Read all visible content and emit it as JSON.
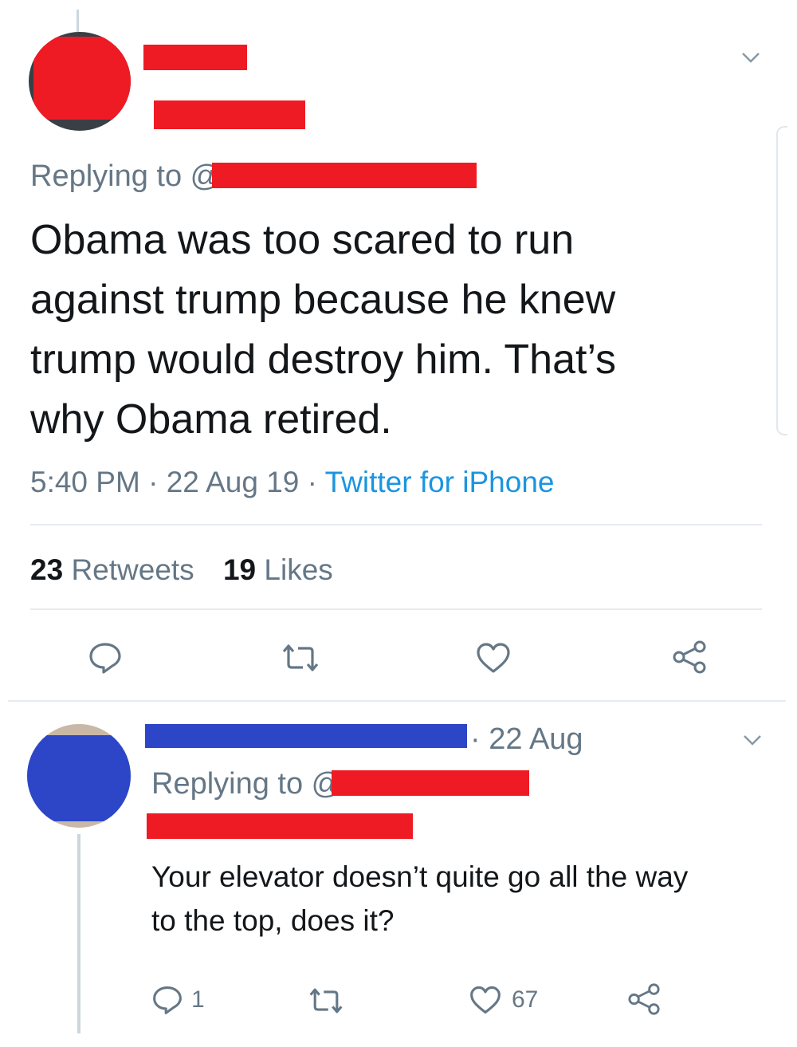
{
  "main_tweet": {
    "replying_prefix": "Replying to @",
    "text_lines": [
      "Obama was too scared to run",
      "against trump because he knew",
      "trump would destroy him. That’s",
      "why Obama retired."
    ],
    "time": "5:40 PM",
    "date": "22 Aug 19",
    "source": "Twitter for iPhone",
    "retweets_count": "23",
    "retweets_label": "Retweets",
    "likes_count": "19",
    "likes_label": "Likes",
    "icons": [
      "reply-icon",
      "retweet-icon",
      "like-icon",
      "share-icon"
    ]
  },
  "reply_tweet": {
    "date": "· 22 Aug",
    "replying_prefix": "Replying to @",
    "text_lines": [
      "Your elevator doesn’t quite go all the way",
      "to the top, does it?"
    ],
    "reply_count": "1",
    "like_count": "67",
    "icons": [
      "reply-icon",
      "retweet-icon",
      "like-icon",
      "share-icon"
    ]
  },
  "colors": {
    "redaction_red": "#ee1b24",
    "redaction_blue": "#2d46c8",
    "link_blue": "#1b95e0",
    "grey": "#657786"
  }
}
